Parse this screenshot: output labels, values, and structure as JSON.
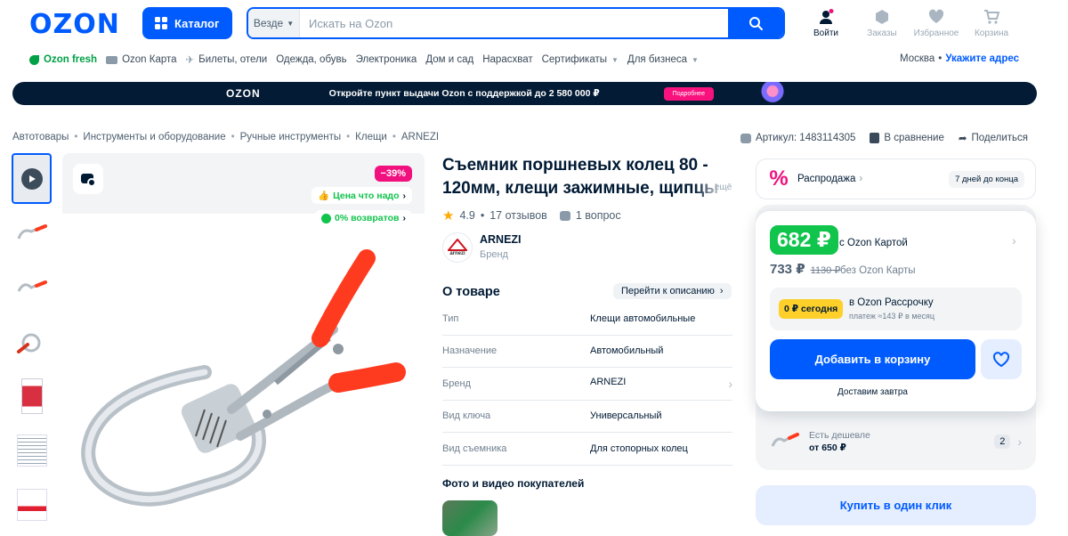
{
  "header": {
    "logo": "OZON",
    "catalog_label": "Каталог",
    "search_scope": "Везде",
    "search_placeholder": "Искать на Ozon",
    "actions": [
      {
        "label": "Войти",
        "icon": "user-icon"
      },
      {
        "label": "Заказы",
        "icon": "box-icon"
      },
      {
        "label": "Избранное",
        "icon": "heart-icon"
      },
      {
        "label": "Корзина",
        "icon": "cart-icon"
      }
    ],
    "colors": {
      "brand": "#005bff",
      "accent": "#f1117e",
      "green": "#10c44c"
    }
  },
  "subnav": {
    "items": [
      "Ozon fresh",
      "Ozon Карта",
      "Билеты, отели",
      "Одежда, обувь",
      "Электроника",
      "Дом и сад",
      "Нарасхват",
      "Сертификаты",
      "Для бизнеса"
    ],
    "city": "Москва",
    "address_link": "Укажите адрес"
  },
  "banner": {
    "logo": "OZON",
    "text": "Откройте пункт выдачи Ozon с поддержкой до 2 580 000 ₽",
    "button": "Подробнее"
  },
  "breadcrumbs": [
    "Автотовары",
    "Инструменты и оборудование",
    "Ручные инструменты",
    "Клещи",
    "ARNEZI"
  ],
  "meta": {
    "sku": "Артикул: 1483114305",
    "compare": "В сравнение",
    "share": "Поделиться"
  },
  "gallery": {
    "discount": "−39%",
    "tag_price": "Цена что надо",
    "tag_returns": "0% возвратов"
  },
  "product": {
    "title": "Съемник поршневых колец 80 - 120мм, клещи зажимные, щипцы",
    "title_more": "ещё",
    "rating": "4.9",
    "reviews": "17 отзывов",
    "questions": "1 вопрос",
    "brand": "ARNEZI",
    "brand_sub": "Бренд",
    "brand_logo_text": "arnezi",
    "about_title": "О товаре",
    "about_link": "Перейти к описанию",
    "specs": [
      {
        "k": "Тип",
        "v": "Клещи автомобильные"
      },
      {
        "k": "Назначение",
        "v": "Автомобильный"
      },
      {
        "k": "Бренд",
        "v": "ARNEZI"
      },
      {
        "k": "Вид ключа",
        "v": "Универсальный"
      },
      {
        "k": "Вид съемника",
        "v": "Для стопорных колец"
      }
    ],
    "photos_title": "Фото и видео покупателей"
  },
  "offer": {
    "sale_label": "Распродажа",
    "sale_days": "7 дней до конца",
    "price_card": "682 ₽",
    "price_card_label": "с Ozon Картой",
    "price": "733 ₽",
    "price_old": "1130 ₽",
    "price_label": "без Ozon Карты",
    "installment_badge": "0 ₽ сегодня",
    "installment_title": "в Ozon Рассрочку",
    "installment_sub": "платеж ≈143 ₽ в месяц",
    "add_to_cart": "Добавить в корзину",
    "delivery": "Доставим завтра",
    "cheaper_label": "Есть дешевле",
    "cheaper_price": "от 650 ₽",
    "cheaper_count": "2",
    "buy_one_click": "Купить в один клик"
  }
}
